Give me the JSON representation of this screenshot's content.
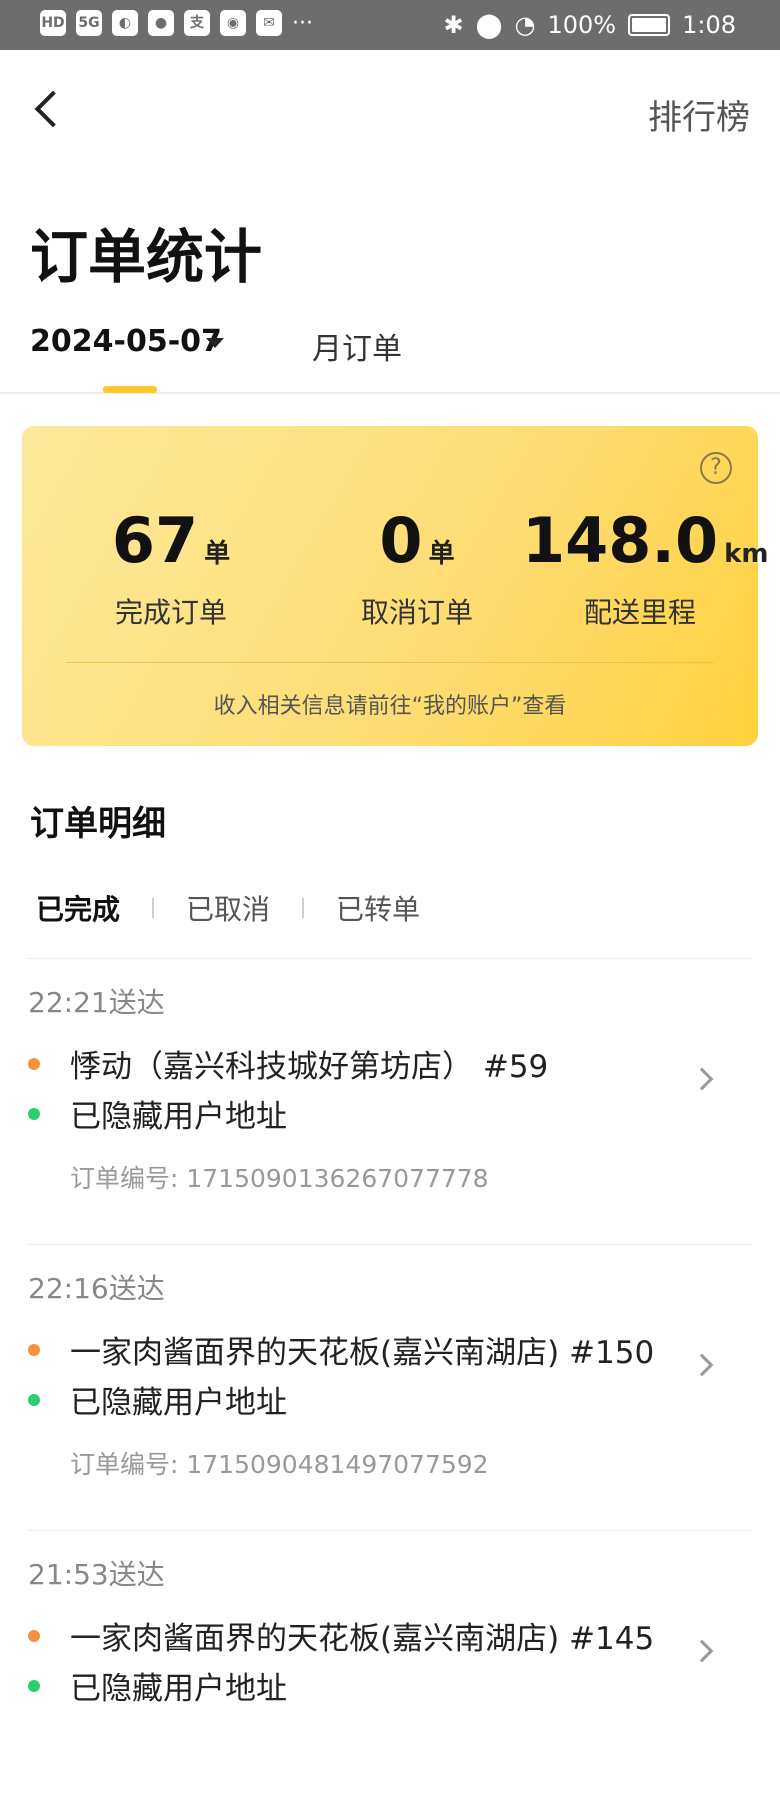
{
  "status_bar": {
    "left_icons": [
      "HD",
      "5G",
      "signal",
      "app",
      "message",
      "alipay",
      "weibo",
      "mail",
      "more"
    ],
    "battery": "100%",
    "time": "1:08"
  },
  "nav": {
    "rank_label": "排行榜"
  },
  "page": {
    "title": "订单统计"
  },
  "date_tabs": {
    "date": "2024-05-07",
    "month_label": "月订单"
  },
  "summary": {
    "completed": {
      "value": "67",
      "unit": "单",
      "label": "完成订单"
    },
    "canceled": {
      "value": "0",
      "unit": "单",
      "label": "取消订单"
    },
    "distance": {
      "value": "148.0",
      "unit": "km",
      "label": "配送里程"
    },
    "note": "收入相关信息请前往“我的账户”查看",
    "help_icon": "?"
  },
  "details": {
    "title": "订单明细",
    "tabs": [
      "已完成",
      "已取消",
      "已转单"
    ]
  },
  "orders": [
    {
      "time": "22:21送达",
      "shop": "悸动（嘉兴科技城好第坊店） #59",
      "address": "已隐藏用户地址",
      "order_no": "订单编号: 1715090136267077778"
    },
    {
      "time": "22:16送达",
      "shop": "一家肉酱面界的天花板(嘉兴南湖店) #150",
      "address": "已隐藏用户地址",
      "order_no": "订单编号: 1715090481497077592"
    },
    {
      "time": "21:53送达",
      "shop": "一家肉酱面界的天花板(嘉兴南湖店) #145",
      "address": "已隐藏用户地址",
      "order_no": ""
    }
  ],
  "colors": {
    "accent": "#ffc928",
    "card_start": "#fde99c",
    "card_end": "#ffd13e",
    "dot_orange": "#f5923e",
    "dot_green": "#2ecc71"
  }
}
